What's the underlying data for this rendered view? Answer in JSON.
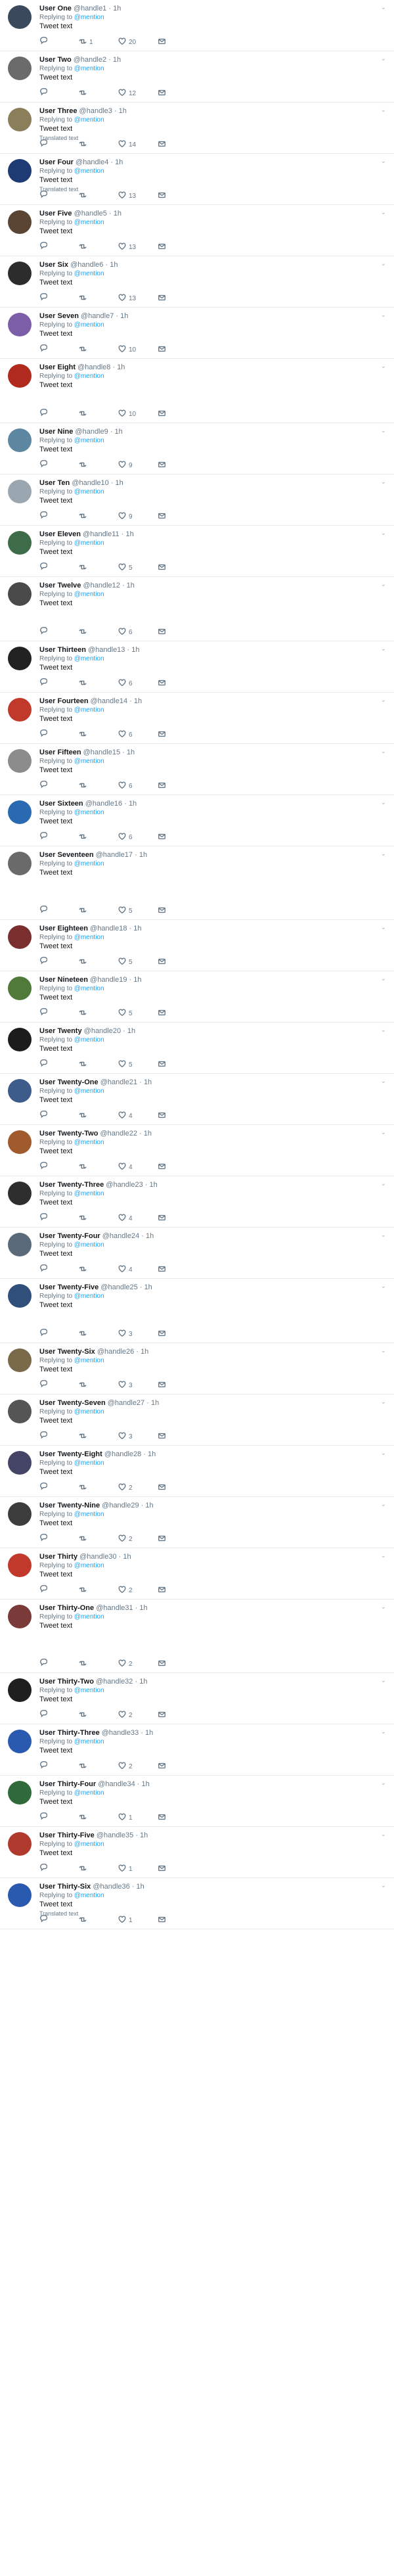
{
  "reply_prefix": "Replying to",
  "reply_target": "@mention",
  "tweets": [
    {
      "name": "User One",
      "handle": "@handle1",
      "time": "· 1h",
      "text": "Tweet text",
      "replies": "",
      "retweets": "1",
      "likes": "20",
      "avatar_color": "#3a4a5c"
    },
    {
      "name": "User Two",
      "handle": "@handle2",
      "time": "· 1h",
      "text": "Tweet text",
      "replies": "",
      "retweets": "",
      "likes": "12",
      "avatar_color": "#6b6b6b"
    },
    {
      "name": "User Three",
      "handle": "@handle3",
      "time": "· 1h",
      "text": "Tweet text",
      "translated": "Translated text",
      "replies": "",
      "retweets": "",
      "likes": "14",
      "avatar_color": "#8a7f5a"
    },
    {
      "name": "User Four",
      "handle": "@handle4",
      "time": "· 1h",
      "text": "Tweet text",
      "translated": "Translated text",
      "replies": "",
      "retweets": "",
      "likes": "13",
      "avatar_color": "#1f3b73"
    },
    {
      "name": "User Five",
      "handle": "@handle5",
      "time": "· 1h",
      "text": "Tweet text",
      "replies": "",
      "retweets": "",
      "likes": "13",
      "avatar_color": "#5a4535"
    },
    {
      "name": "User Six",
      "handle": "@handle6",
      "time": "· 1h",
      "text": "Tweet text",
      "replies": "",
      "retweets": "",
      "likes": "13",
      "avatar_color": "#2c2c2c"
    },
    {
      "name": "User Seven",
      "handle": "@handle7",
      "time": "· 1h",
      "text": "Tweet text",
      "replies": "",
      "retweets": "",
      "likes": "10",
      "avatar_color": "#7b5ea7"
    },
    {
      "name": "User Eight",
      "handle": "@handle8",
      "time": "· 1h",
      "text": "Tweet text",
      "tall": true,
      "replies": "",
      "retweets": "",
      "likes": "10",
      "avatar_color": "#b02a1e"
    },
    {
      "name": "User Nine",
      "handle": "@handle9",
      "time": "· 1h",
      "text": "Tweet text",
      "replies": "",
      "retweets": "",
      "likes": "9",
      "avatar_color": "#5d87a1"
    },
    {
      "name": "User Ten",
      "handle": "@handle10",
      "time": "· 1h",
      "text": "Tweet text",
      "replies": "",
      "retweets": "",
      "likes": "9",
      "avatar_color": "#9aa7b0"
    },
    {
      "name": "User Eleven",
      "handle": "@handle11",
      "time": "· 1h",
      "text": "Tweet text",
      "replies": "",
      "retweets": "",
      "likes": "5",
      "avatar_color": "#3e6b48"
    },
    {
      "name": "User Twelve",
      "handle": "@handle12",
      "time": "· 1h",
      "text": "Tweet text",
      "tall": true,
      "replies": "",
      "retweets": "",
      "likes": "6",
      "avatar_color": "#4a4a4a"
    },
    {
      "name": "User Thirteen",
      "handle": "@handle13",
      "time": "· 1h",
      "text": "Tweet text",
      "replies": "",
      "retweets": "",
      "likes": "6",
      "avatar_color": "#222222"
    },
    {
      "name": "User Fourteen",
      "handle": "@handle14",
      "time": "· 1h",
      "text": "Tweet text",
      "replies": "",
      "retweets": "",
      "likes": "6",
      "avatar_color": "#c0392b"
    },
    {
      "name": "User Fifteen",
      "handle": "@handle15",
      "time": "· 1h",
      "text": "Tweet text",
      "replies": "",
      "retweets": "",
      "likes": "6",
      "avatar_color": "#8c8c8c"
    },
    {
      "name": "User Sixteen",
      "handle": "@handle16",
      "time": "· 1h",
      "text": "Tweet text",
      "replies": "",
      "retweets": "",
      "likes": "6",
      "avatar_color": "#2a6ab0"
    },
    {
      "name": "User Seventeen",
      "handle": "@handle17",
      "time": "· 1h",
      "text": "Tweet text",
      "xtall": true,
      "replies": "",
      "retweets": "",
      "likes": "5",
      "avatar_color": "#6a6a6a"
    },
    {
      "name": "User Eighteen",
      "handle": "@handle18",
      "time": "· 1h",
      "text": "Tweet text",
      "replies": "",
      "retweets": "",
      "likes": "5",
      "avatar_color": "#7a2e2e"
    },
    {
      "name": "User Nineteen",
      "handle": "@handle19",
      "time": "· 1h",
      "text": "Tweet text",
      "replies": "",
      "retweets": "",
      "likes": "5",
      "avatar_color": "#4f7a3a"
    },
    {
      "name": "User Twenty",
      "handle": "@handle20",
      "time": "· 1h",
      "text": "Tweet text",
      "replies": "",
      "retweets": "",
      "likes": "5",
      "avatar_color": "#1c1c1c"
    },
    {
      "name": "User Twenty-One",
      "handle": "@handle21",
      "time": "· 1h",
      "text": "Tweet text",
      "replies": "",
      "retweets": "",
      "likes": "4",
      "avatar_color": "#3d5c8a"
    },
    {
      "name": "User Twenty-Two",
      "handle": "@handle22",
      "time": "· 1h",
      "text": "Tweet text",
      "replies": "",
      "retweets": "",
      "likes": "4",
      "avatar_color": "#a05a2c"
    },
    {
      "name": "User Twenty-Three",
      "handle": "@handle23",
      "time": "· 1h",
      "text": "Tweet text",
      "replies": "",
      "retweets": "",
      "likes": "4",
      "avatar_color": "#2e2e2e"
    },
    {
      "name": "User Twenty-Four",
      "handle": "@handle24",
      "time": "· 1h",
      "text": "Tweet text",
      "replies": "",
      "retweets": "",
      "likes": "4",
      "avatar_color": "#5a6a7a"
    },
    {
      "name": "User Twenty-Five",
      "handle": "@handle25",
      "time": "· 1h",
      "text": "Tweet text",
      "tall": true,
      "replies": "",
      "retweets": "",
      "likes": "3",
      "avatar_color": "#304f7a"
    },
    {
      "name": "User Twenty-Six",
      "handle": "@handle26",
      "time": "· 1h",
      "text": "Tweet text",
      "replies": "",
      "retweets": "",
      "likes": "3",
      "avatar_color": "#7a6a4a"
    },
    {
      "name": "User Twenty-Seven",
      "handle": "@handle27",
      "time": "· 1h",
      "text": "Tweet text",
      "replies": "",
      "retweets": "",
      "likes": "3",
      "avatar_color": "#555555"
    },
    {
      "name": "User Twenty-Eight",
      "handle": "@handle28",
      "time": "· 1h",
      "text": "Tweet text",
      "replies": "",
      "retweets": "",
      "likes": "2",
      "avatar_color": "#444466"
    },
    {
      "name": "User Twenty-Nine",
      "handle": "@handle29",
      "time": "· 1h",
      "text": "Tweet text",
      "replies": "",
      "retweets": "",
      "likes": "2",
      "avatar_color": "#3c3c3c"
    },
    {
      "name": "User Thirty",
      "handle": "@handle30",
      "time": "· 1h",
      "text": "Tweet text",
      "replies": "",
      "retweets": "",
      "likes": "2",
      "avatar_color": "#c0392b"
    },
    {
      "name": "User Thirty-One",
      "handle": "@handle31",
      "time": "· 1h",
      "text": "Tweet text",
      "xtall": true,
      "replies": "",
      "retweets": "",
      "likes": "2",
      "avatar_color": "#7a3a3a"
    },
    {
      "name": "User Thirty-Two",
      "handle": "@handle32",
      "time": "· 1h",
      "text": "Tweet text",
      "replies": "",
      "retweets": "",
      "likes": "2",
      "avatar_color": "#1f1f1f"
    },
    {
      "name": "User Thirty-Three",
      "handle": "@handle33",
      "time": "· 1h",
      "text": "Tweet text",
      "replies": "",
      "retweets": "",
      "likes": "2",
      "avatar_color": "#2a5ab0"
    },
    {
      "name": "User Thirty-Four",
      "handle": "@handle34",
      "time": "· 1h",
      "text": "Tweet text",
      "replies": "",
      "retweets": "",
      "likes": "1",
      "avatar_color": "#2f6b3a"
    },
    {
      "name": "User Thirty-Five",
      "handle": "@handle35",
      "time": "· 1h",
      "text": "Tweet text",
      "replies": "",
      "retweets": "",
      "likes": "1",
      "avatar_color": "#b03a2e"
    },
    {
      "name": "User Thirty-Six",
      "handle": "@handle36",
      "time": "· 1h",
      "text": "Tweet text",
      "translated": "Translated text",
      "replies": "",
      "retweets": "",
      "likes": "1",
      "avatar_color": "#2a5ab0"
    }
  ]
}
